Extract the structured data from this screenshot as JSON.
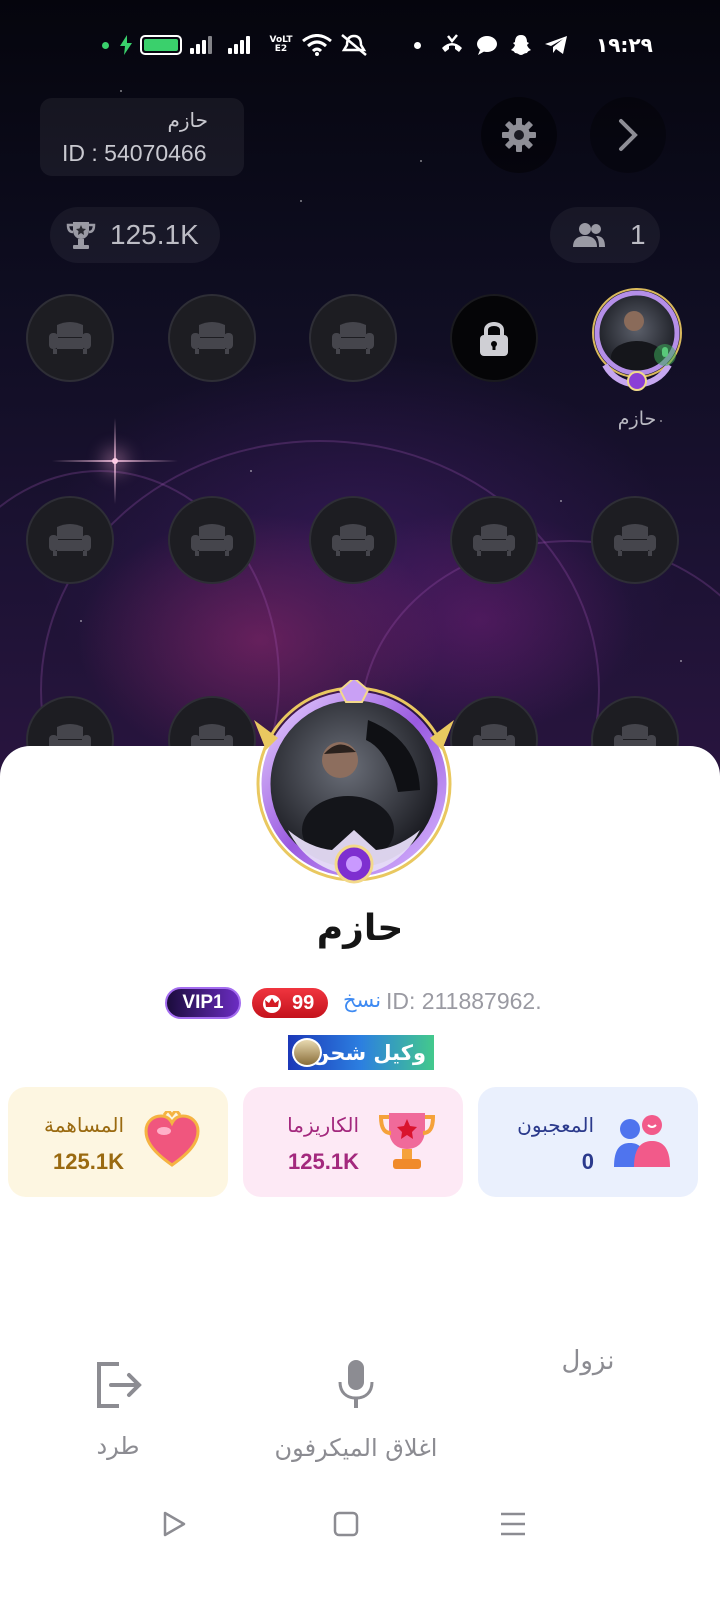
{
  "status_bar": {
    "clock": "١٩:٢٩",
    "network_label": "VoLTE2",
    "icons": [
      "green-dot",
      "charging-icon",
      "battery-icon",
      "signal-icon",
      "signal-icon",
      "volte-icon",
      "wifi-icon",
      "mute-icon",
      "dot-icon",
      "call-icon",
      "chat-icon",
      "snapchat-icon",
      "telegram-icon"
    ],
    "battery_level": 1.0,
    "colors": {
      "accent": "#3ad06c"
    }
  },
  "room": {
    "name": "حازم",
    "id": "ID : 54070466",
    "trophy_count": "125.1K",
    "online_count": "1"
  },
  "seats": {
    "occupant_name": "حازم"
  },
  "profile": {
    "name": "حازم",
    "user_id": "ID: 211887962.",
    "copy_label": "نسخ",
    "level": "99",
    "vip": "VIP1",
    "agent_banner": "وكيل شحن"
  },
  "stats": [
    {
      "label": "المعجبون",
      "value": "0",
      "icon": "fans-icon",
      "bg": "#eaf0fd",
      "color": "#2b3a8c"
    },
    {
      "label": "الكاريزما",
      "value": "125.1K",
      "icon": "trophy-icon",
      "bg": "#fde9f5",
      "color": "#a3287d"
    },
    {
      "label": "المساهمة",
      "value": "125.1K",
      "icon": "heart-icon",
      "bg": "#fdf6e1",
      "color": "#9a6a10"
    }
  ],
  "actions": {
    "kick": "طرد",
    "mute_mic": "اغلاق الميكرفون",
    "leave_seat": "نزول"
  },
  "nav": [
    "back-icon",
    "home-icon",
    "recents-icon"
  ]
}
